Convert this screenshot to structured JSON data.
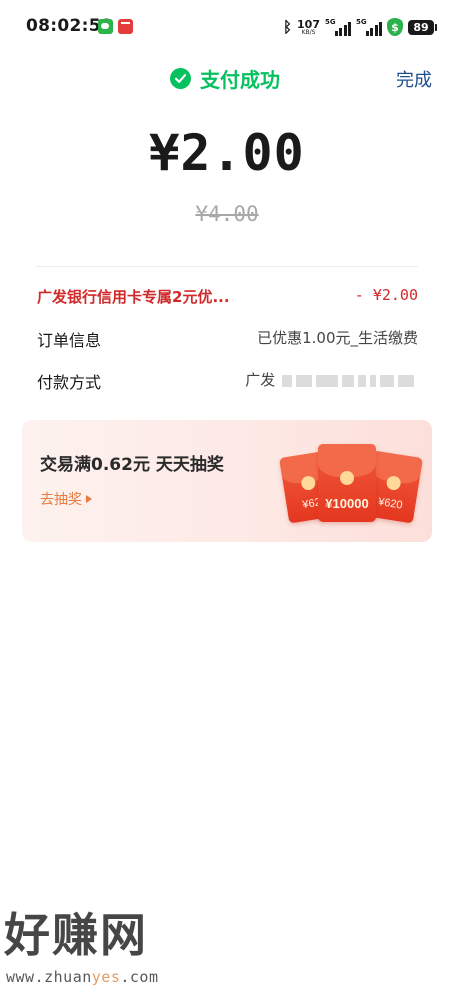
{
  "status_bar": {
    "time": "08:02:59",
    "bluetooth_icon": "bluetooth-icon",
    "net_speed_value": "107",
    "net_speed_unit": "KB/S",
    "signal1_label": "5G",
    "signal2_label": "5G",
    "battery": "89",
    "colors": {
      "shield": "#2bb24c"
    }
  },
  "header": {
    "title": "支付成功",
    "done_label": "完成",
    "colors": {
      "success": "#07c160",
      "done": "#1f4e8c"
    }
  },
  "payment": {
    "amount": "¥2.00",
    "original_amount": "¥4.00"
  },
  "details": {
    "discount_label": "广发银行信用卡专属2元优...",
    "discount_value": "- ¥2.00",
    "order_label": "订单信息",
    "order_value": "已优惠1.00元_生活缴费",
    "method_label": "付款方式",
    "method_value": "广发",
    "colors": {
      "discount": "#d02a2a"
    }
  },
  "promo": {
    "title": "交易满0.62元  天天抽奖",
    "link_label": "去抽奖",
    "envelopes": [
      "¥62",
      "¥10000",
      "¥620"
    ],
    "colors": {
      "link": "#e77a3c",
      "envelope": "#e4371f"
    }
  },
  "watermark": {
    "logo": "好赚网",
    "url_prefix": "www.zhuan",
    "url_accent": "yes",
    "url_suffix": ".com"
  }
}
